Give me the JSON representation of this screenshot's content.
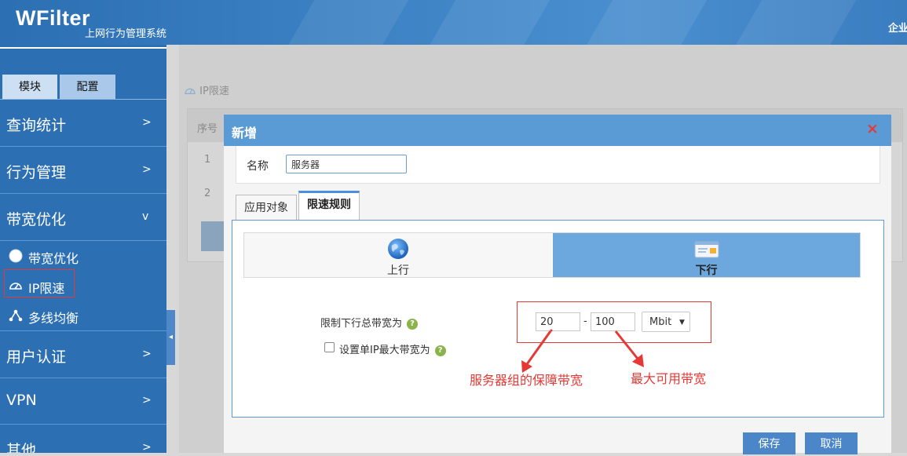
{
  "header": {
    "logo": "WFilter",
    "subtitle": "上网行为管理系统",
    "right_text": "企业"
  },
  "sidebar": {
    "tabs": [
      "模块",
      "配置"
    ],
    "menu": [
      {
        "label": "查询统计",
        "arrow": ">"
      },
      {
        "label": "行为管理",
        "arrow": ">"
      },
      {
        "label": "带宽优化",
        "arrow": "v"
      },
      {
        "label": "用户认证",
        "arrow": ">"
      },
      {
        "label": "VPN",
        "arrow": ">"
      },
      {
        "label": "其他",
        "arrow": ">"
      }
    ],
    "submenu": [
      {
        "label": "带宽优化",
        "icon": "circle-icon"
      },
      {
        "label": "IP限速",
        "icon": "speedometer-icon"
      },
      {
        "label": "多线均衡",
        "icon": "network-icon"
      }
    ],
    "collapse": "◂"
  },
  "main": {
    "title": "IP限速",
    "table": {
      "header": "序号",
      "rows": [
        "1",
        "2"
      ]
    }
  },
  "modal": {
    "title": "新增",
    "close": "×",
    "name_label": "名称",
    "name_value": "服务器",
    "tabs": [
      "应用对象",
      "限速规则"
    ],
    "direction": {
      "up": "上行",
      "down": "下行"
    },
    "total_label": "限制下行总带宽为",
    "single_label": "设置单IP最大带宽为",
    "help": "?",
    "min_value": "20",
    "dash": "-",
    "max_value": "100",
    "unit": "Mbit",
    "unit_arrow": "▼",
    "annotation_min": "服务器组的保障带宽",
    "annotation_max": "最大可用带宽",
    "save": "保存",
    "cancel": "取消"
  },
  "colors": {
    "primary": "#2c6fb3",
    "modal_header": "#5b9bd5",
    "active_direction": "#6ca7dd",
    "annotation": "#e53935"
  }
}
